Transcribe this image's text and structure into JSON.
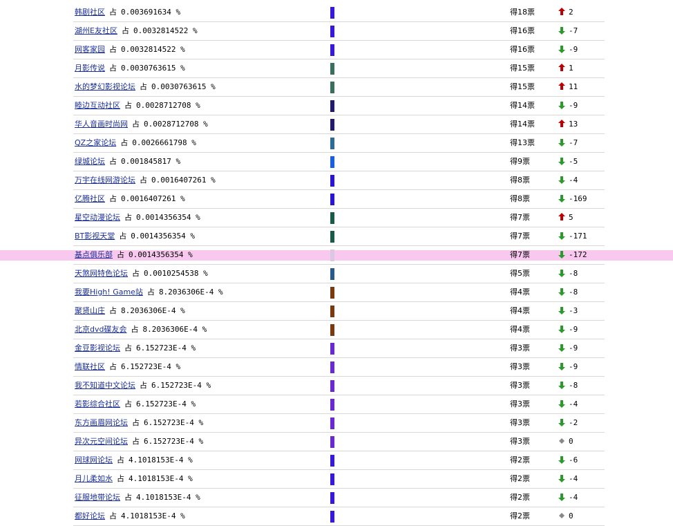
{
  "colors": {
    "link": "#1b2f9a",
    "highlight": "#f8c8ee",
    "up": "#c00000",
    "down": "#2a9a2a",
    "same": "#888888"
  },
  "rows": [
    {
      "name": "韩剧社区",
      "zhan": "占",
      "pct": "0.003691634 %",
      "bar": "#3a18d8",
      "votes": "得18票",
      "trend": "up",
      "change": "2"
    },
    {
      "name": "湖州E友社区",
      "zhan": "占",
      "pct": "0.0032814522 %",
      "bar": "#3a18d8",
      "votes": "得16票",
      "trend": "down",
      "change": "-7"
    },
    {
      "name": "网客家园",
      "zhan": "占",
      "pct": "0.0032814522 %",
      "bar": "#3a18d8",
      "votes": "得16票",
      "trend": "down",
      "change": "-9"
    },
    {
      "name": "月影传说",
      "zhan": "占",
      "pct": "0.0030763615 %",
      "bar": "#3a6e5e",
      "votes": "得15票",
      "trend": "up",
      "change": "1"
    },
    {
      "name": "水的梦幻影视论坛",
      "zhan": "占",
      "pct": "0.0030763615 %",
      "bar": "#3a6e5e",
      "votes": "得15票",
      "trend": "up",
      "change": "11"
    },
    {
      "name": "睦边互动社区",
      "zhan": "占",
      "pct": "0.0028712708 %",
      "bar": "#221a6a",
      "votes": "得14票",
      "trend": "down",
      "change": "-9"
    },
    {
      "name": "华人音画时尚网",
      "zhan": "占",
      "pct": "0.0028712708 %",
      "bar": "#221a6a",
      "votes": "得14票",
      "trend": "up",
      "change": "13"
    },
    {
      "name": "QZ之家论坛",
      "zhan": "占",
      "pct": "0.0026661798 %",
      "bar": "#2c6a98",
      "votes": "得13票",
      "trend": "down",
      "change": "-7"
    },
    {
      "name": "绿城论坛",
      "zhan": "占",
      "pct": "0.001845817 %",
      "bar": "#1a5ee0",
      "votes": "得9票",
      "trend": "down",
      "change": "-5"
    },
    {
      "name": "万宇在线网游论坛",
      "zhan": "占",
      "pct": "0.0016407261 %",
      "bar": "#2a16d0",
      "votes": "得8票",
      "trend": "down",
      "change": "-4"
    },
    {
      "name": "亿腾社区",
      "zhan": "占",
      "pct": "0.0016407261 %",
      "bar": "#2a16d0",
      "votes": "得8票",
      "trend": "down",
      "change": "-169"
    },
    {
      "name": "星空动漫论坛",
      "zhan": "占",
      "pct": "0.0014356354 %",
      "bar": "#1a5a48",
      "votes": "得7票",
      "trend": "up",
      "change": "5"
    },
    {
      "name": "BT影视天堂",
      "zhan": "占",
      "pct": "0.0014356354 %",
      "bar": "#1a5a48",
      "votes": "得7票",
      "trend": "down",
      "change": "-171"
    },
    {
      "name": "基点俱乐部",
      "zhan": "占",
      "pct": "0.0014356354 %",
      "bar": "#d8c8e0",
      "votes": "得7票",
      "trend": "down",
      "change": "-172",
      "highlight": true
    },
    {
      "name": "天煞网特色论坛",
      "zhan": "占",
      "pct": "0.0010254538 %",
      "bar": "#2a5a8a",
      "votes": "得5票",
      "trend": "down",
      "change": "-8"
    },
    {
      "name": "我要High! Game站",
      "zhan": "占",
      "pct": "8.2036306E-4 %",
      "bar": "#7a3a10",
      "votes": "得4票",
      "trend": "down",
      "change": "-8"
    },
    {
      "name": "聚贤山庄",
      "zhan": "占",
      "pct": "8.2036306E-4 %",
      "bar": "#7a3a10",
      "votes": "得4票",
      "trend": "down",
      "change": "-3"
    },
    {
      "name": "北京dvd碟友会",
      "zhan": "占",
      "pct": "8.2036306E-4 %",
      "bar": "#7a3a10",
      "votes": "得4票",
      "trend": "down",
      "change": "-9"
    },
    {
      "name": "金豆影视论坛",
      "zhan": "占",
      "pct": "6.152723E-4 %",
      "bar": "#6a2ad0",
      "votes": "得3票",
      "trend": "down",
      "change": "-9"
    },
    {
      "name": "情联社区",
      "zhan": "占",
      "pct": "6.152723E-4 %",
      "bar": "#6a2ad0",
      "votes": "得3票",
      "trend": "down",
      "change": "-9"
    },
    {
      "name": "我不知道中文论坛",
      "zhan": "占",
      "pct": "6.152723E-4 %",
      "bar": "#6a2ad0",
      "votes": "得3票",
      "trend": "down",
      "change": "-8"
    },
    {
      "name": "若影综合社区",
      "zhan": "占",
      "pct": "6.152723E-4 %",
      "bar": "#6a2ad0",
      "votes": "得3票",
      "trend": "down",
      "change": "-4"
    },
    {
      "name": "东方画眉网论坛",
      "zhan": "占",
      "pct": "6.152723E-4 %",
      "bar": "#6a2ad0",
      "votes": "得3票",
      "trend": "down",
      "change": "-2"
    },
    {
      "name": "异次元空间论坛",
      "zhan": "占",
      "pct": "6.152723E-4 %",
      "bar": "#6a2ad0",
      "votes": "得3票",
      "trend": "same",
      "change": "0"
    },
    {
      "name": "网球网论坛",
      "zhan": "占",
      "pct": "4.1018153E-4 %",
      "bar": "#3a18d8",
      "votes": "得2票",
      "trend": "down",
      "change": "-6"
    },
    {
      "name": "月儿柔如水",
      "zhan": "占",
      "pct": "4.1018153E-4 %",
      "bar": "#3a18d8",
      "votes": "得2票",
      "trend": "down",
      "change": "-4"
    },
    {
      "name": "征服地带论坛",
      "zhan": "占",
      "pct": "4.1018153E-4 %",
      "bar": "#3a18d8",
      "votes": "得2票",
      "trend": "down",
      "change": "-4"
    },
    {
      "name": "都好论坛",
      "zhan": "占",
      "pct": "4.1018153E-4 %",
      "bar": "#3a18d8",
      "votes": "得2票",
      "trend": "same",
      "change": "0"
    }
  ]
}
